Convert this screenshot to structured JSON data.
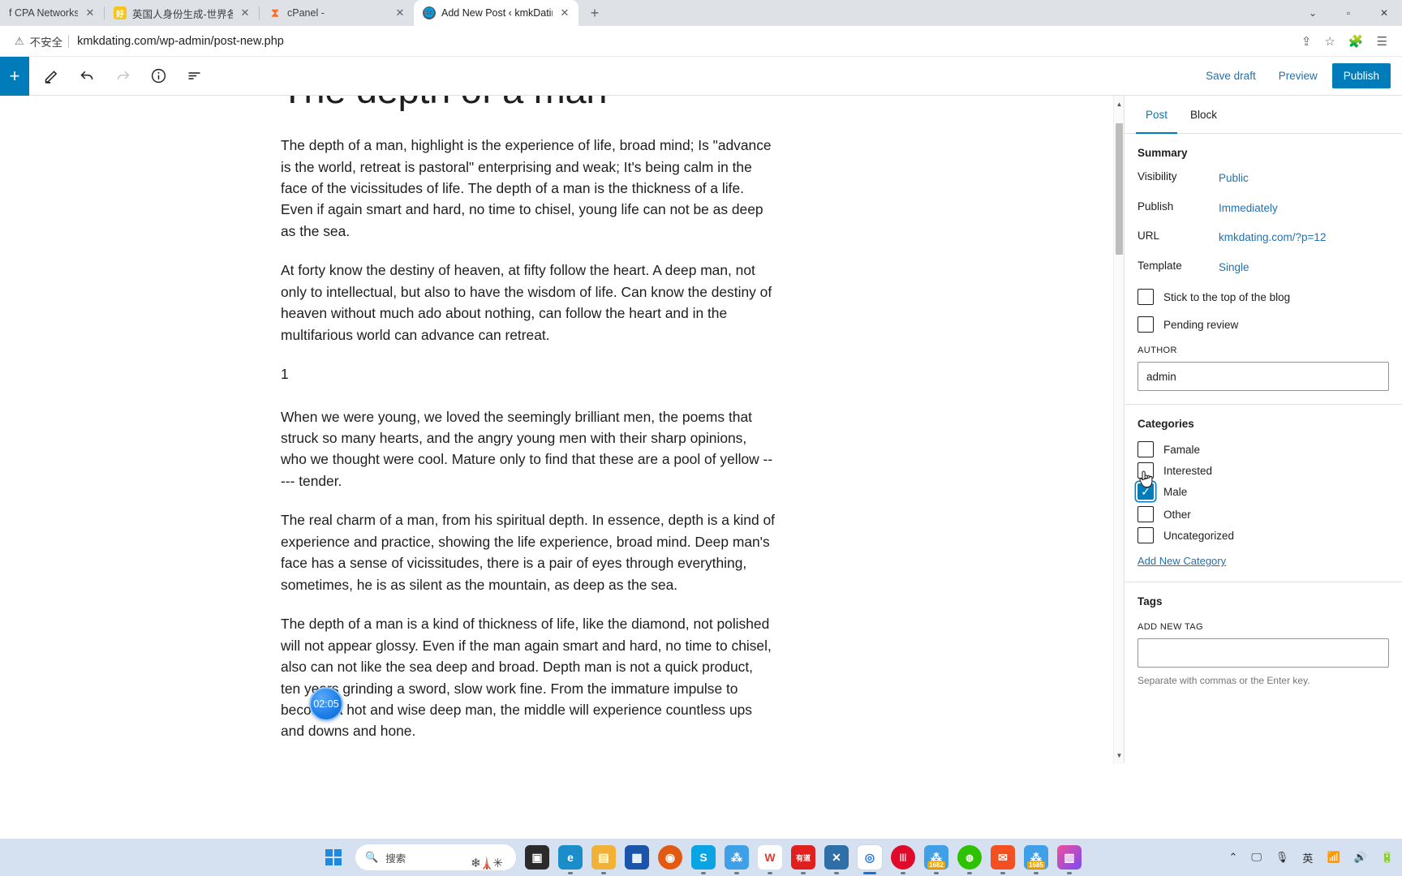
{
  "browser": {
    "tabs": [
      {
        "title": "f CPA Networks, Affi",
        "favicon": "blank-icon",
        "active": false
      },
      {
        "title": "英国人身份生成-世界各国虚拟身",
        "favicon": "yellow-square-icon",
        "active": false
      },
      {
        "title": "cPanel -",
        "favicon": "cpanel-icon",
        "active": false
      },
      {
        "title": "Add New Post ‹ kmkDating —",
        "favicon": "globe-icon",
        "active": true
      }
    ],
    "new_tab_label": "+",
    "window_controls": {
      "minimize": "⌄",
      "maximize": "▫",
      "close": "✕"
    },
    "address": {
      "security_warning": "不安全",
      "url": "kmkdating.com/wp-admin/post-new.php"
    },
    "toolbar_icons": [
      "share-icon",
      "bookmark-star-icon",
      "extensions-puzzle-icon",
      "reading-list-icon"
    ]
  },
  "editor_header": {
    "add_block_label": "+",
    "tools": [
      "pencil-edit-icon",
      "undo-arrow-icon",
      "redo-arrow-icon",
      "info-circle-icon",
      "list-view-icon"
    ],
    "save_draft_label": "Save draft",
    "preview_label": "Preview",
    "publish_label": "Publish",
    "accent_color": "#007cba"
  },
  "post": {
    "title": "The depth of a man",
    "paragraphs": [
      "The depth of a man, highlight is the experience of life, broad mind; Is \"advance is the world, retreat is pastoral\" enterprising and weak; It's being calm in the face of the vicissitudes of life. The depth of a man is the thickness of a life. Even if again smart and hard, no time to chisel, young life can not be as deep as the sea.",
      "At forty know the destiny of heaven, at fifty follow the heart. A deep man, not only to intellectual, but also to have the wisdom of life. Can know the destiny of heaven without much ado about nothing, can follow the heart and in the multifarious world can advance can retreat.",
      "1",
      "When we were young, we loved the seemingly brilliant men, the poems that struck so many hearts, and the angry young men with their sharp opinions, who we thought were cool. Mature only to find that these are a pool of yellow ----- tender.",
      "The real charm of a man, from his spiritual depth. In essence, depth is a kind of experience and practice, showing the life experience, broad mind. Deep man's face has a sense of vicissitudes, there is a pair of eyes through everything, sometimes, he is as silent as the mountain, as deep as the sea.",
      "The depth of a man is a kind of thickness of life, like the diamond, not polished will not appear glossy. Even if the man again smart and hard, no time to chisel, also can not like the sea deep and broad. Depth man is not a quick product, ten years grinding a sword, slow work fine. From the immature impulse to become a hot and wise deep man, the middle will experience countless ups and downs and hone."
    ]
  },
  "sidebar": {
    "tabs": [
      {
        "label": "Post",
        "selected": true
      },
      {
        "label": "Block",
        "selected": false
      }
    ],
    "summary": {
      "heading": "Summary",
      "rows": [
        {
          "label": "Visibility",
          "value": "Public"
        },
        {
          "label": "Publish",
          "value": "Immediately"
        },
        {
          "label": "URL",
          "value": "kmkdating.com/?p=12"
        },
        {
          "label": "Template",
          "value": "Single"
        }
      ],
      "checkboxes": [
        {
          "label": "Stick to the top of the blog",
          "checked": false
        },
        {
          "label": "Pending review",
          "checked": false
        }
      ]
    },
    "author": {
      "heading": "AUTHOR",
      "value": "admin"
    },
    "categories": {
      "heading": "Categories",
      "items": [
        {
          "label": "Famale",
          "checked": false
        },
        {
          "label": "Interested",
          "checked": false
        },
        {
          "label": "Male",
          "checked": true
        },
        {
          "label": "Other",
          "checked": false
        },
        {
          "label": "Uncategorized",
          "checked": false
        }
      ],
      "add_link": "Add New Category"
    },
    "tags": {
      "heading": "Tags",
      "add_label": "ADD NEW TAG",
      "value": "",
      "help": "Separate with commas or the Enter key."
    }
  },
  "overlay": {
    "timer_label": "02:05"
  },
  "taskbar": {
    "search_placeholder": "搜索",
    "apps": [
      {
        "name": "file-explorer-dark-icon",
        "glyph": "▣",
        "color": "#2b2b2b",
        "running": false
      },
      {
        "name": "microsoft-edge-icon",
        "glyph": "e",
        "color": "#0e7ec1",
        "running": true
      },
      {
        "name": "file-explorer-icon",
        "glyph": "🗀",
        "color": "#f2b137",
        "running": true
      },
      {
        "name": "microsoft-store-icon",
        "glyph": "▦",
        "color": "#1b54a8",
        "running": false
      },
      {
        "name": "firefox-icon",
        "glyph": "◉",
        "color": "#e25a12",
        "running": false
      },
      {
        "name": "skype-icon",
        "glyph": "S",
        "color": "#0aa4e5",
        "running": true
      },
      {
        "name": "network-tool-icon",
        "glyph": "⁂",
        "color": "#3fa0e8",
        "running": true
      },
      {
        "name": "wps-office-icon",
        "glyph": "W",
        "color": "#e03c31",
        "running": true
      },
      {
        "name": "youdao-dict-icon",
        "glyph": "有道",
        "color": "#e01f1f",
        "running": true
      },
      {
        "name": "vs-code-icon",
        "glyph": "✕",
        "color": "#3b7dbf",
        "running": true
      },
      {
        "name": "google-chrome-icon",
        "glyph": "◎",
        "color": "#ffffff",
        "running": true
      },
      {
        "name": "red-app-icon",
        "glyph": "|||",
        "color": "#e00b2b",
        "running": true
      },
      {
        "name": "network-tool-badge-icon",
        "glyph": "⁂",
        "color": "#3fa0e8",
        "badge": "1682",
        "running": true
      },
      {
        "name": "wechat-icon",
        "glyph": "💬",
        "color": "#2dc100",
        "running": true
      },
      {
        "name": "foxmail-icon",
        "glyph": "✉",
        "color": "#f25022",
        "running": true
      },
      {
        "name": "network-tool-badge2-icon",
        "glyph": "⁂",
        "color": "#3fa0e8",
        "badge": "1685",
        "running": true
      },
      {
        "name": "colorful-app-icon",
        "glyph": "▥",
        "color": "#b84df0",
        "running": true
      }
    ],
    "tray": [
      {
        "name": "chevron-up-icon",
        "glyph": "⌃"
      },
      {
        "name": "display-icon",
        "glyph": "🖳"
      },
      {
        "name": "microphone-icon",
        "glyph": "🎤"
      },
      {
        "name": "ime-language-icon",
        "glyph": "英"
      },
      {
        "name": "wifi-icon",
        "glyph": "◗"
      },
      {
        "name": "volume-icon",
        "glyph": "🔊"
      },
      {
        "name": "battery-icon",
        "glyph": "▭"
      }
    ]
  }
}
